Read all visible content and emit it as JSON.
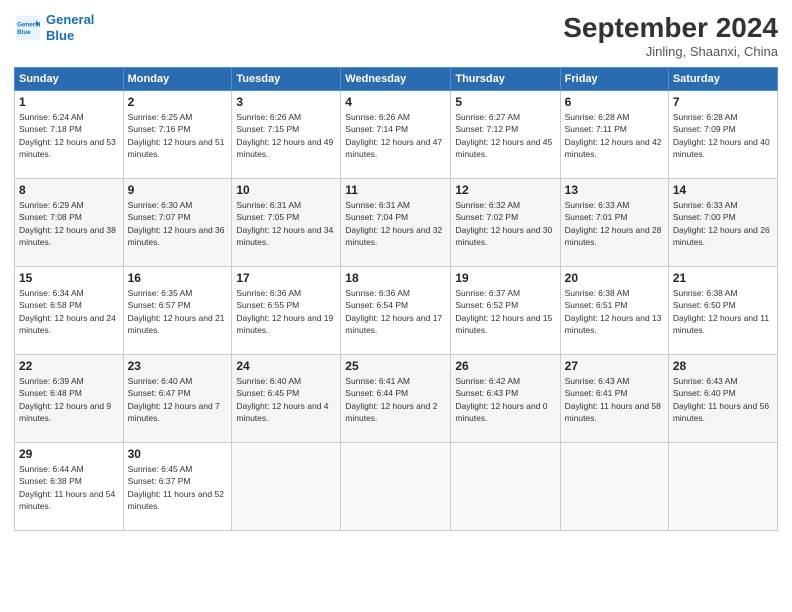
{
  "header": {
    "logo_line1": "General",
    "logo_line2": "Blue",
    "month": "September 2024",
    "location": "Jinling, Shaanxi, China"
  },
  "weekdays": [
    "Sunday",
    "Monday",
    "Tuesday",
    "Wednesday",
    "Thursday",
    "Friday",
    "Saturday"
  ],
  "weeks": [
    [
      {
        "day": "1",
        "sunrise": "6:24 AM",
        "sunset": "7:18 PM",
        "daylight": "12 hours and 53 minutes."
      },
      {
        "day": "2",
        "sunrise": "6:25 AM",
        "sunset": "7:16 PM",
        "daylight": "12 hours and 51 minutes."
      },
      {
        "day": "3",
        "sunrise": "6:26 AM",
        "sunset": "7:15 PM",
        "daylight": "12 hours and 49 minutes."
      },
      {
        "day": "4",
        "sunrise": "6:26 AM",
        "sunset": "7:14 PM",
        "daylight": "12 hours and 47 minutes."
      },
      {
        "day": "5",
        "sunrise": "6:27 AM",
        "sunset": "7:12 PM",
        "daylight": "12 hours and 45 minutes."
      },
      {
        "day": "6",
        "sunrise": "6:28 AM",
        "sunset": "7:11 PM",
        "daylight": "12 hours and 42 minutes."
      },
      {
        "day": "7",
        "sunrise": "6:28 AM",
        "sunset": "7:09 PM",
        "daylight": "12 hours and 40 minutes."
      }
    ],
    [
      {
        "day": "8",
        "sunrise": "6:29 AM",
        "sunset": "7:08 PM",
        "daylight": "12 hours and 38 minutes."
      },
      {
        "day": "9",
        "sunrise": "6:30 AM",
        "sunset": "7:07 PM",
        "daylight": "12 hours and 36 minutes."
      },
      {
        "day": "10",
        "sunrise": "6:31 AM",
        "sunset": "7:05 PM",
        "daylight": "12 hours and 34 minutes."
      },
      {
        "day": "11",
        "sunrise": "6:31 AM",
        "sunset": "7:04 PM",
        "daylight": "12 hours and 32 minutes."
      },
      {
        "day": "12",
        "sunrise": "6:32 AM",
        "sunset": "7:02 PM",
        "daylight": "12 hours and 30 minutes."
      },
      {
        "day": "13",
        "sunrise": "6:33 AM",
        "sunset": "7:01 PM",
        "daylight": "12 hours and 28 minutes."
      },
      {
        "day": "14",
        "sunrise": "6:33 AM",
        "sunset": "7:00 PM",
        "daylight": "12 hours and 26 minutes."
      }
    ],
    [
      {
        "day": "15",
        "sunrise": "6:34 AM",
        "sunset": "6:58 PM",
        "daylight": "12 hours and 24 minutes."
      },
      {
        "day": "16",
        "sunrise": "6:35 AM",
        "sunset": "6:57 PM",
        "daylight": "12 hours and 21 minutes."
      },
      {
        "day": "17",
        "sunrise": "6:36 AM",
        "sunset": "6:55 PM",
        "daylight": "12 hours and 19 minutes."
      },
      {
        "day": "18",
        "sunrise": "6:36 AM",
        "sunset": "6:54 PM",
        "daylight": "12 hours and 17 minutes."
      },
      {
        "day": "19",
        "sunrise": "6:37 AM",
        "sunset": "6:52 PM",
        "daylight": "12 hours and 15 minutes."
      },
      {
        "day": "20",
        "sunrise": "6:38 AM",
        "sunset": "6:51 PM",
        "daylight": "12 hours and 13 minutes."
      },
      {
        "day": "21",
        "sunrise": "6:38 AM",
        "sunset": "6:50 PM",
        "daylight": "12 hours and 11 minutes."
      }
    ],
    [
      {
        "day": "22",
        "sunrise": "6:39 AM",
        "sunset": "6:48 PM",
        "daylight": "12 hours and 9 minutes."
      },
      {
        "day": "23",
        "sunrise": "6:40 AM",
        "sunset": "6:47 PM",
        "daylight": "12 hours and 7 minutes."
      },
      {
        "day": "24",
        "sunrise": "6:40 AM",
        "sunset": "6:45 PM",
        "daylight": "12 hours and 4 minutes."
      },
      {
        "day": "25",
        "sunrise": "6:41 AM",
        "sunset": "6:44 PM",
        "daylight": "12 hours and 2 minutes."
      },
      {
        "day": "26",
        "sunrise": "6:42 AM",
        "sunset": "6:43 PM",
        "daylight": "12 hours and 0 minutes."
      },
      {
        "day": "27",
        "sunrise": "6:43 AM",
        "sunset": "6:41 PM",
        "daylight": "11 hours and 58 minutes."
      },
      {
        "day": "28",
        "sunrise": "6:43 AM",
        "sunset": "6:40 PM",
        "daylight": "11 hours and 56 minutes."
      }
    ],
    [
      {
        "day": "29",
        "sunrise": "6:44 AM",
        "sunset": "6:38 PM",
        "daylight": "11 hours and 54 minutes."
      },
      {
        "day": "30",
        "sunrise": "6:45 AM",
        "sunset": "6:37 PM",
        "daylight": "11 hours and 52 minutes."
      },
      null,
      null,
      null,
      null,
      null
    ]
  ]
}
